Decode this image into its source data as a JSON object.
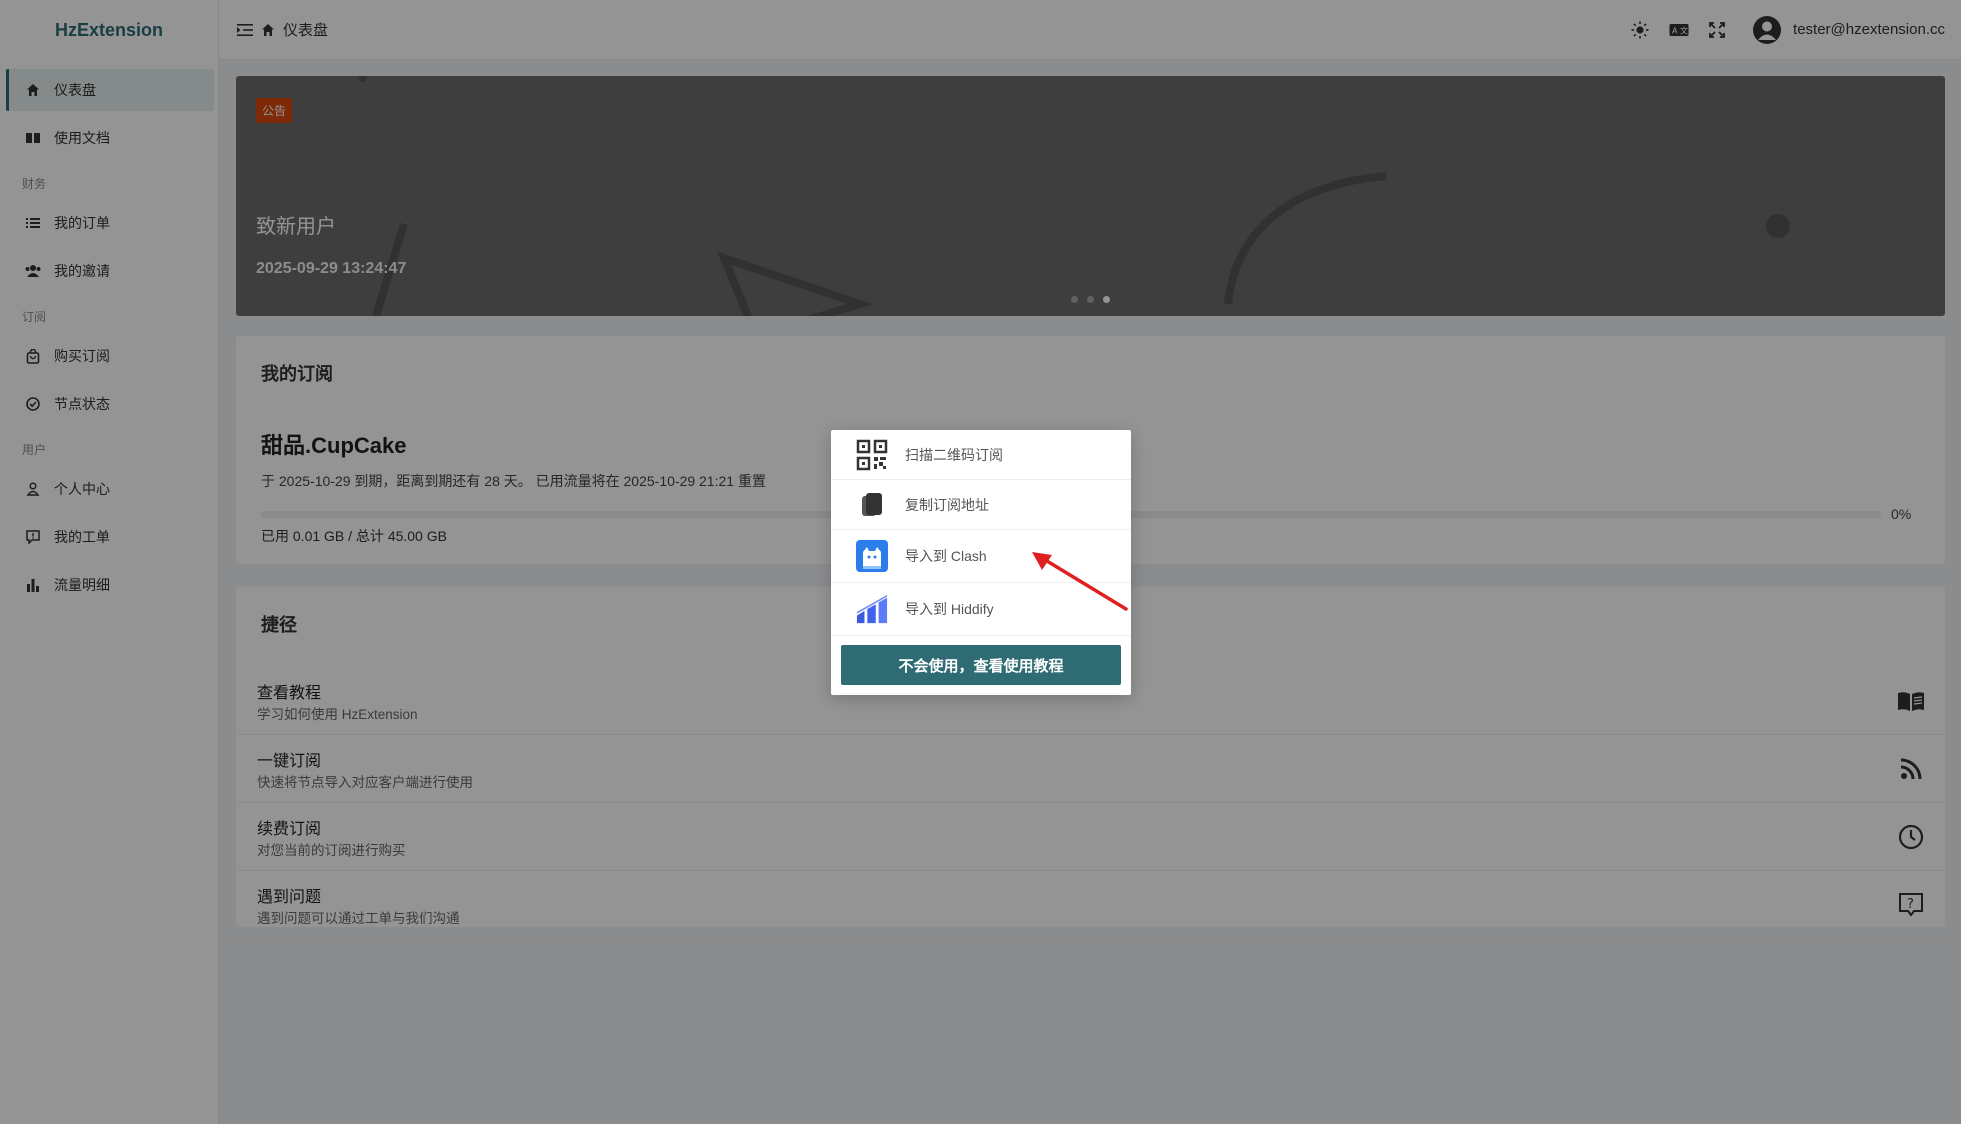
{
  "app": {
    "brand": "HzExtension"
  },
  "sidebar": {
    "items": [
      {
        "label": "仪表盘",
        "icon": "home-icon",
        "active": true
      },
      {
        "label": "使用文档",
        "icon": "book-icon"
      },
      {
        "group": "财务"
      },
      {
        "label": "我的订单",
        "icon": "list-icon"
      },
      {
        "label": "我的邀请",
        "icon": "users-icon"
      },
      {
        "group": "订阅"
      },
      {
        "label": "购买订阅",
        "icon": "bag-icon"
      },
      {
        "label": "节点状态",
        "icon": "check-circle-icon"
      },
      {
        "group": "用户"
      },
      {
        "label": "个人中心",
        "icon": "user-icon"
      },
      {
        "label": "我的工单",
        "icon": "ticket-icon"
      },
      {
        "label": "流量明细",
        "icon": "bar-chart-icon"
      }
    ]
  },
  "header": {
    "breadcrumb": "仪表盘",
    "user_email": "tester@hzextension.cc"
  },
  "banner": {
    "tag": "公告",
    "title": "致新用户",
    "date": "2025-09-29 13:24:47",
    "slide_count": 3,
    "active_slide": 3
  },
  "subscription": {
    "title": "我的订阅",
    "plan_name": "甜品.CupCake",
    "description": "于 2025-10-29 到期，距离到期还有 28 天。 已用流量将在 2025-10-29 21:21 重置",
    "progress_percent": 0,
    "progress_label": "0%",
    "usage": "已用 0.01 GB / 总计 45.00 GB"
  },
  "shortcuts": {
    "title": "捷径",
    "items": [
      {
        "title": "查看教程",
        "desc": "学习如何使用 HzExtension",
        "icon": "book-open-icon"
      },
      {
        "title": "一键订阅",
        "desc": "快速将节点导入对应客户端进行使用",
        "icon": "rss-icon"
      },
      {
        "title": "续费订阅",
        "desc": "对您当前的订阅进行购买",
        "icon": "clock-icon"
      },
      {
        "title": "遇到问题",
        "desc": "遇到问题可以通过工单与我们沟通",
        "icon": "help-message-icon"
      }
    ]
  },
  "popup": {
    "items": [
      {
        "label": "扫描二维码订阅",
        "icon": "qrcode-icon"
      },
      {
        "label": "复制订阅地址",
        "icon": "copy-icon"
      },
      {
        "label": "导入到 Clash",
        "icon": "clash-icon"
      },
      {
        "label": "导入到 Hiddify",
        "icon": "hiddify-icon"
      }
    ],
    "button_label": "不会使用，查看使用教程"
  },
  "colors": {
    "accent": "#2e6b73",
    "tag": "#d9480f",
    "annotation_arrow": "#e02020"
  }
}
